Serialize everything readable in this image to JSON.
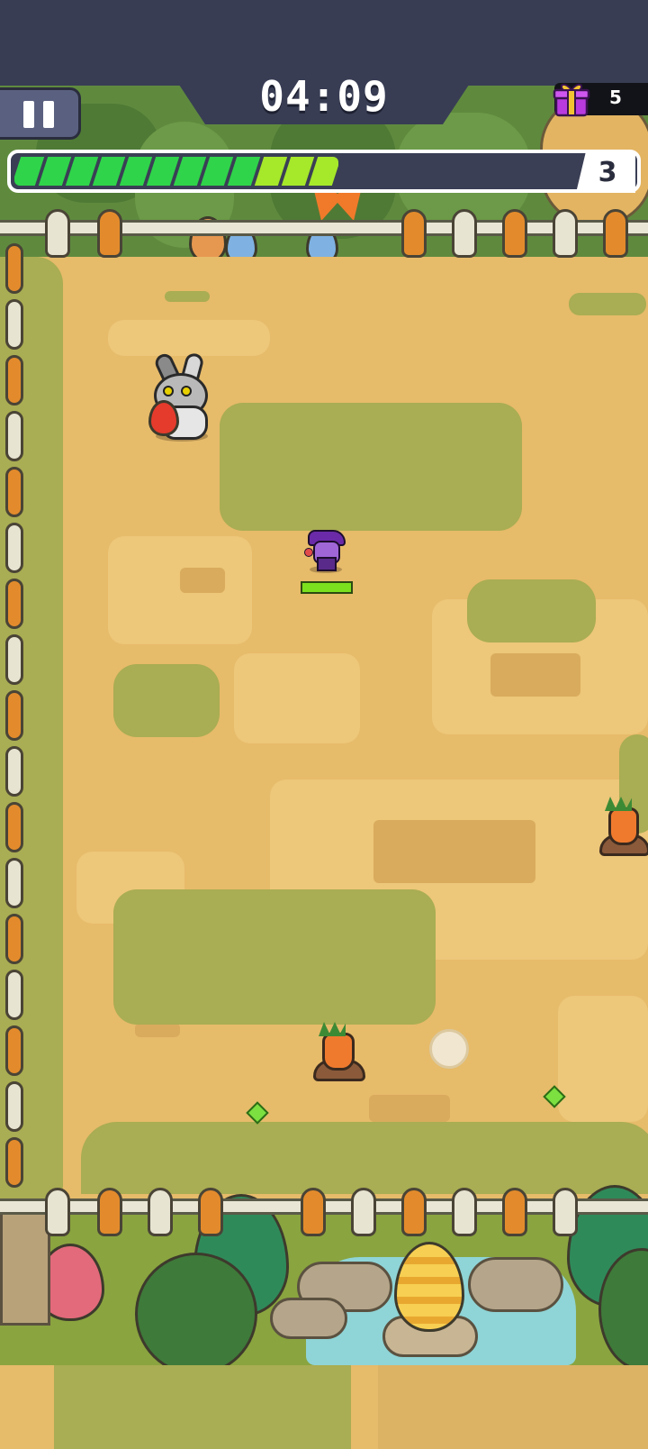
{
  "hud": {
    "timer": "04:09",
    "gift_count": "5",
    "level": "3",
    "xp_progress": 0.58,
    "xp_segments": 12
  },
  "colors": {
    "ground": "#e6bb6a",
    "grass_patch": "#a9ad53",
    "xp_green": "#2fd44a",
    "xp_lime": "#a6e82a",
    "hud_dark": "#383d54",
    "gift_purple": "#b93be0"
  },
  "icons": {
    "pause": "pause-icon",
    "gift": "gift-icon",
    "player": "witch-player-sprite",
    "enemy": "bunny-enemy-sprite",
    "carrot": "carrot-sprite",
    "gem": "xp-gem-icon"
  },
  "player": {
    "health": 1.0
  }
}
